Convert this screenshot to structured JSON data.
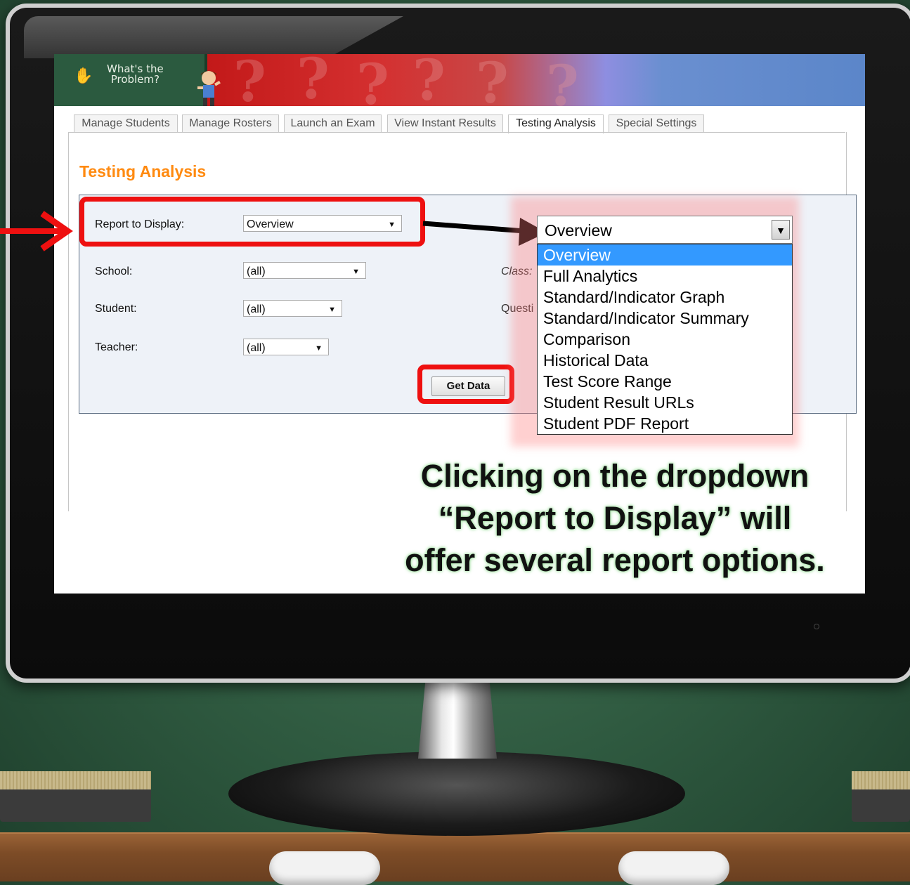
{
  "app": {
    "logo_line1": "What's the",
    "logo_line2": "Problem?"
  },
  "tabs": [
    {
      "label": "Manage Students"
    },
    {
      "label": "Manage Rosters"
    },
    {
      "label": "Launch an Exam"
    },
    {
      "label": "View Instant Results"
    },
    {
      "label": "Testing Analysis"
    },
    {
      "label": "Special Settings"
    }
  ],
  "page": {
    "title": "Testing Analysis"
  },
  "form": {
    "report_label": "Report to Display:",
    "report_value": "Overview",
    "school_label": "School:",
    "school_value": "(all)",
    "student_label": "Student:",
    "student_value": "(all)",
    "teacher_label": "Teacher:",
    "teacher_value": "(all)",
    "class_label": "Class:",
    "question_label": "Questi",
    "get_data_label": "Get Data"
  },
  "dropdown": {
    "selected": "Overview",
    "options": [
      "Overview",
      "Full Analytics",
      "Standard/Indicator Graph",
      "Standard/Indicator Summary",
      "Comparison",
      "Historical Data",
      "Test Score Range",
      "Student Result URLs",
      "Student PDF Report"
    ]
  },
  "caption": {
    "line1": "Clicking on the dropdown",
    "line2": "“Report to Display” will",
    "line3": "offer several report options."
  },
  "colors": {
    "accent_orange": "#ff8a10",
    "highlight_red": "#ee1010",
    "selected_blue": "#3399ff"
  }
}
